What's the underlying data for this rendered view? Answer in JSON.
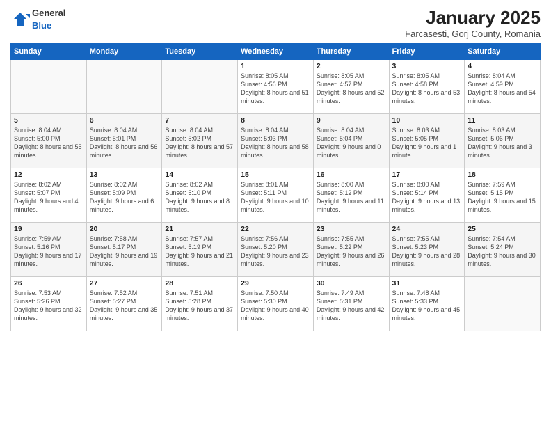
{
  "logo": {
    "general": "General",
    "blue": "Blue"
  },
  "header": {
    "month": "January 2025",
    "location": "Farcasesti, Gorj County, Romania"
  },
  "weekdays": [
    "Sunday",
    "Monday",
    "Tuesday",
    "Wednesday",
    "Thursday",
    "Friday",
    "Saturday"
  ],
  "weeks": [
    [
      {
        "day": "",
        "text": ""
      },
      {
        "day": "",
        "text": ""
      },
      {
        "day": "",
        "text": ""
      },
      {
        "day": "1",
        "text": "Sunrise: 8:05 AM\nSunset: 4:56 PM\nDaylight: 8 hours and 51 minutes."
      },
      {
        "day": "2",
        "text": "Sunrise: 8:05 AM\nSunset: 4:57 PM\nDaylight: 8 hours and 52 minutes."
      },
      {
        "day": "3",
        "text": "Sunrise: 8:05 AM\nSunset: 4:58 PM\nDaylight: 8 hours and 53 minutes."
      },
      {
        "day": "4",
        "text": "Sunrise: 8:04 AM\nSunset: 4:59 PM\nDaylight: 8 hours and 54 minutes."
      }
    ],
    [
      {
        "day": "5",
        "text": "Sunrise: 8:04 AM\nSunset: 5:00 PM\nDaylight: 8 hours and 55 minutes."
      },
      {
        "day": "6",
        "text": "Sunrise: 8:04 AM\nSunset: 5:01 PM\nDaylight: 8 hours and 56 minutes."
      },
      {
        "day": "7",
        "text": "Sunrise: 8:04 AM\nSunset: 5:02 PM\nDaylight: 8 hours and 57 minutes."
      },
      {
        "day": "8",
        "text": "Sunrise: 8:04 AM\nSunset: 5:03 PM\nDaylight: 8 hours and 58 minutes."
      },
      {
        "day": "9",
        "text": "Sunrise: 8:04 AM\nSunset: 5:04 PM\nDaylight: 9 hours and 0 minutes."
      },
      {
        "day": "10",
        "text": "Sunrise: 8:03 AM\nSunset: 5:05 PM\nDaylight: 9 hours and 1 minute."
      },
      {
        "day": "11",
        "text": "Sunrise: 8:03 AM\nSunset: 5:06 PM\nDaylight: 9 hours and 3 minutes."
      }
    ],
    [
      {
        "day": "12",
        "text": "Sunrise: 8:02 AM\nSunset: 5:07 PM\nDaylight: 9 hours and 4 minutes."
      },
      {
        "day": "13",
        "text": "Sunrise: 8:02 AM\nSunset: 5:09 PM\nDaylight: 9 hours and 6 minutes."
      },
      {
        "day": "14",
        "text": "Sunrise: 8:02 AM\nSunset: 5:10 PM\nDaylight: 9 hours and 8 minutes."
      },
      {
        "day": "15",
        "text": "Sunrise: 8:01 AM\nSunset: 5:11 PM\nDaylight: 9 hours and 10 minutes."
      },
      {
        "day": "16",
        "text": "Sunrise: 8:00 AM\nSunset: 5:12 PM\nDaylight: 9 hours and 11 minutes."
      },
      {
        "day": "17",
        "text": "Sunrise: 8:00 AM\nSunset: 5:14 PM\nDaylight: 9 hours and 13 minutes."
      },
      {
        "day": "18",
        "text": "Sunrise: 7:59 AM\nSunset: 5:15 PM\nDaylight: 9 hours and 15 minutes."
      }
    ],
    [
      {
        "day": "19",
        "text": "Sunrise: 7:59 AM\nSunset: 5:16 PM\nDaylight: 9 hours and 17 minutes."
      },
      {
        "day": "20",
        "text": "Sunrise: 7:58 AM\nSunset: 5:17 PM\nDaylight: 9 hours and 19 minutes."
      },
      {
        "day": "21",
        "text": "Sunrise: 7:57 AM\nSunset: 5:19 PM\nDaylight: 9 hours and 21 minutes."
      },
      {
        "day": "22",
        "text": "Sunrise: 7:56 AM\nSunset: 5:20 PM\nDaylight: 9 hours and 23 minutes."
      },
      {
        "day": "23",
        "text": "Sunrise: 7:55 AM\nSunset: 5:22 PM\nDaylight: 9 hours and 26 minutes."
      },
      {
        "day": "24",
        "text": "Sunrise: 7:55 AM\nSunset: 5:23 PM\nDaylight: 9 hours and 28 minutes."
      },
      {
        "day": "25",
        "text": "Sunrise: 7:54 AM\nSunset: 5:24 PM\nDaylight: 9 hours and 30 minutes."
      }
    ],
    [
      {
        "day": "26",
        "text": "Sunrise: 7:53 AM\nSunset: 5:26 PM\nDaylight: 9 hours and 32 minutes."
      },
      {
        "day": "27",
        "text": "Sunrise: 7:52 AM\nSunset: 5:27 PM\nDaylight: 9 hours and 35 minutes."
      },
      {
        "day": "28",
        "text": "Sunrise: 7:51 AM\nSunset: 5:28 PM\nDaylight: 9 hours and 37 minutes."
      },
      {
        "day": "29",
        "text": "Sunrise: 7:50 AM\nSunset: 5:30 PM\nDaylight: 9 hours and 40 minutes."
      },
      {
        "day": "30",
        "text": "Sunrise: 7:49 AM\nSunset: 5:31 PM\nDaylight: 9 hours and 42 minutes."
      },
      {
        "day": "31",
        "text": "Sunrise: 7:48 AM\nSunset: 5:33 PM\nDaylight: 9 hours and 45 minutes."
      },
      {
        "day": "",
        "text": ""
      }
    ]
  ]
}
